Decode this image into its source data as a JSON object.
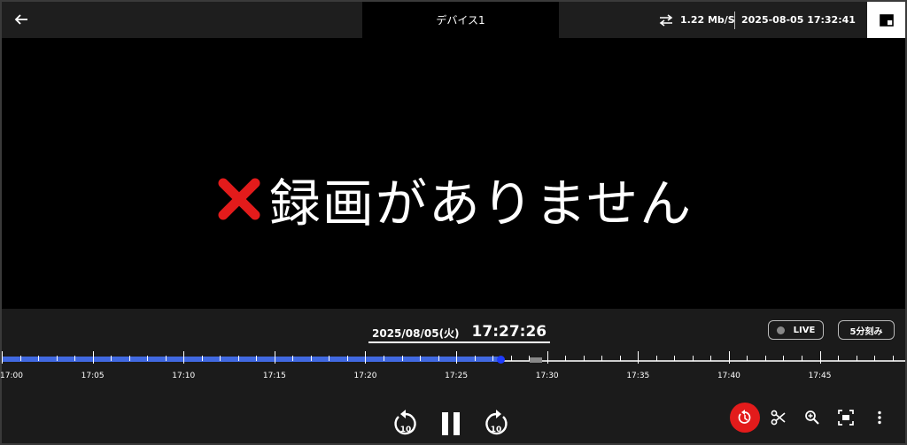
{
  "header": {
    "title": "デバイス1",
    "bitrate": "1.22 Mb/S",
    "datetime": "2025-08-05 17:32:41"
  },
  "video": {
    "message": "録画がありません",
    "status_icon": "close-icon"
  },
  "playback": {
    "date": "2025/08/05(火)",
    "time": "17:27:26",
    "live_label": "LIVE",
    "interval_label": "5分刻み"
  },
  "timeline": {
    "labels": [
      "17:00",
      "17:05",
      "17:10",
      "17:15",
      "17:20",
      "17:25",
      "17:30",
      "17:35",
      "17:40",
      "17:45"
    ],
    "range_minutes": [
      0,
      49.7
    ],
    "recorded_until_minute": 27.43,
    "cursor_minute": 27.43,
    "gap_marker_minute": 29.7,
    "colors": {
      "recorded": "#4169e1",
      "cursor": "#1e3cff",
      "gap": "#888888"
    }
  },
  "tools": [
    {
      "icon": "history-icon",
      "active": true
    },
    {
      "icon": "scissors-icon"
    },
    {
      "icon": "zoom-icon"
    },
    {
      "icon": "fullscreen-icon"
    },
    {
      "icon": "more-icon"
    }
  ],
  "player": {
    "rewind": "10",
    "forward": "10"
  },
  "colors": {
    "accent": "#e31b1b",
    "bar": "#1e1e1e"
  }
}
